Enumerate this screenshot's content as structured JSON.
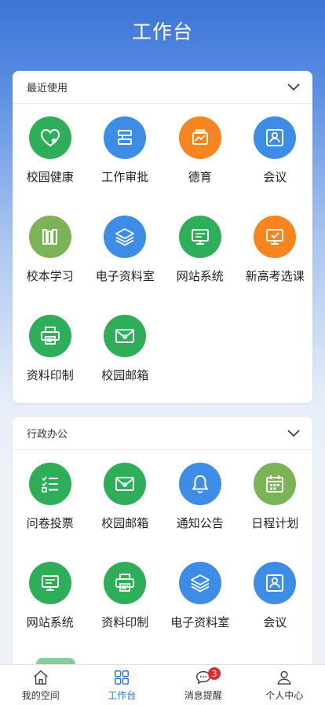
{
  "header": {
    "title": "工作台"
  },
  "recent": {
    "title": "最近使用",
    "items": [
      {
        "label": "校园健康",
        "icon": "heart-icon",
        "color": "#2fae5a"
      },
      {
        "label": "工作审批",
        "icon": "approval-icon",
        "color": "#3d8de6"
      },
      {
        "label": "德育",
        "icon": "moral-icon",
        "color": "#f6851f"
      },
      {
        "label": "会议",
        "icon": "meeting-icon",
        "color": "#3d8de6"
      },
      {
        "label": "校本学习",
        "icon": "books-icon",
        "color": "#7bb456"
      },
      {
        "label": "电子资料室",
        "icon": "layers-icon",
        "color": "#3d8de6"
      },
      {
        "label": "网站系统",
        "icon": "monitor-icon",
        "color": "#2fae5a"
      },
      {
        "label": "新高考选课",
        "icon": "screen-course-icon",
        "color": "#f6851f"
      },
      {
        "label": "资料印制",
        "icon": "printer-icon",
        "color": "#2fae5a"
      },
      {
        "label": "校园邮箱",
        "icon": "mail-icon",
        "color": "#2fae5a"
      }
    ]
  },
  "office": {
    "title": "行政办公",
    "items": [
      {
        "label": "问卷投票",
        "icon": "checklist-icon",
        "color": "#2fae5a"
      },
      {
        "label": "校园邮箱",
        "icon": "mail-icon",
        "color": "#2fae5a"
      },
      {
        "label": "通知公告",
        "icon": "bell-icon",
        "color": "#3d8de6"
      },
      {
        "label": "日程计划",
        "icon": "calendar-icon",
        "color": "#7bb456"
      },
      {
        "label": "网站系统",
        "icon": "monitor-icon",
        "color": "#2fae5a"
      },
      {
        "label": "资料印制",
        "icon": "printer-icon",
        "color": "#2fae5a"
      },
      {
        "label": "电子资料室",
        "icon": "layers-icon",
        "color": "#3d8de6"
      },
      {
        "label": "会议",
        "icon": "meeting-icon",
        "color": "#3d8de6"
      }
    ]
  },
  "tabbar": {
    "tabs": [
      {
        "label": "我的空间",
        "icon": "home-icon"
      },
      {
        "label": "工作台",
        "icon": "grid-icon",
        "active": true
      },
      {
        "label": "消息提醒",
        "icon": "chat-icon",
        "badge": "3"
      },
      {
        "label": "个人中心",
        "icon": "user-icon"
      }
    ]
  }
}
